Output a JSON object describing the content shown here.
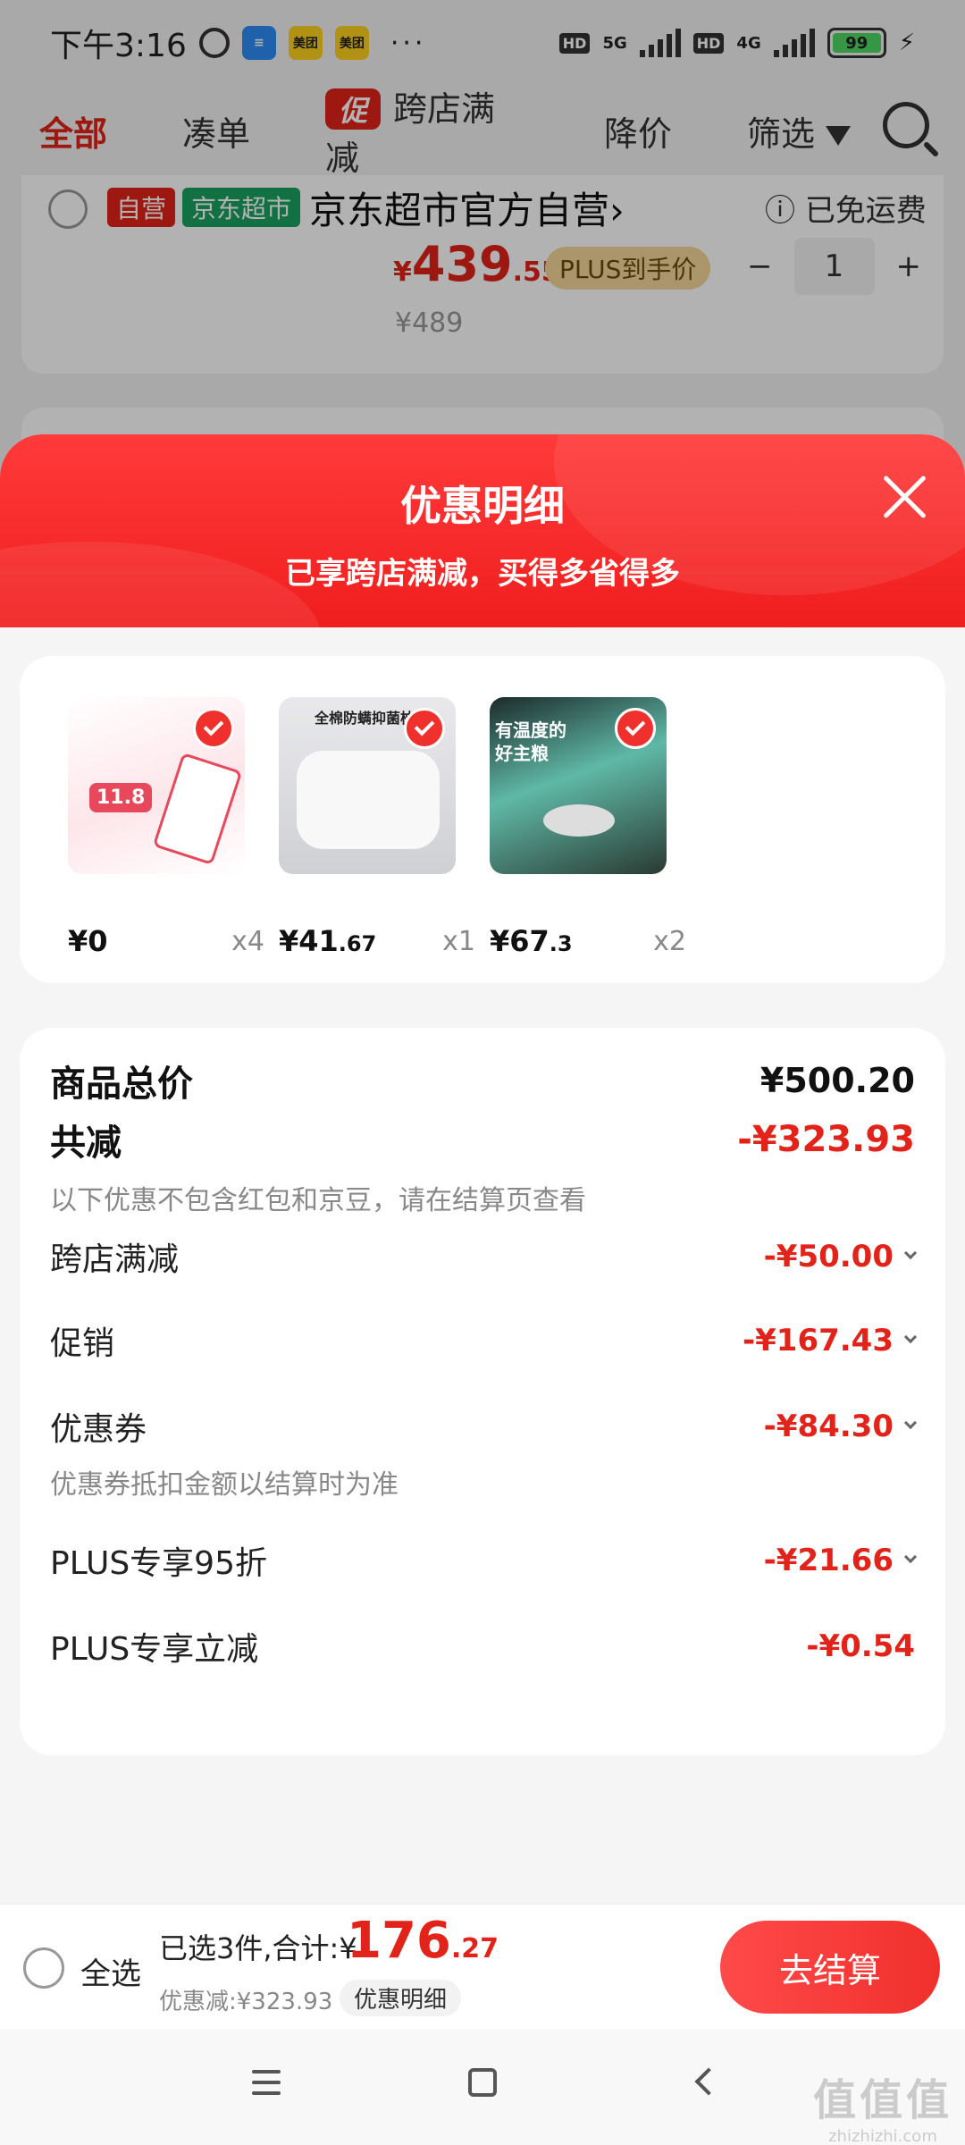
{
  "status_bar": {
    "time": "下午3:16",
    "app_icon_meituan": "美团",
    "dots": "···",
    "signal_1": "5G",
    "signal_2": "4G",
    "hd": "HD",
    "battery": "99"
  },
  "filter_bar": {
    "all": "全部",
    "combine": "凑单",
    "promo_tag": "促",
    "cross_store": "跨店满减",
    "price_drop": "降价",
    "filter": "筛选"
  },
  "background_store": {
    "tag_self": "自营",
    "tag_market": "京东超市",
    "name": "京东超市官方自营",
    "chevron": "›",
    "shipping": "已免运费",
    "price_symbol": "¥",
    "price_int": "439",
    "price_dec": ".55",
    "plus_label": "PLUS到手价",
    "minus": "−",
    "qty": "1",
    "plus": "+",
    "old_price": "¥489"
  },
  "sheet": {
    "title": "优惠明细",
    "subtitle": "已享跨店满减，买得多省得多"
  },
  "products": [
    {
      "price_int": "¥0",
      "price_dec": "",
      "qty": "x4",
      "thumb_text": "11.8"
    },
    {
      "price_int": "¥41",
      "price_dec": ".67",
      "qty": "x1",
      "thumb_text": "全棉防螨抑菌枕"
    },
    {
      "price_int": "¥67",
      "price_dec": ".3",
      "qty": "x2",
      "thumb_text": "有温度的好主粮"
    }
  ],
  "details": {
    "total_label": "商品总价",
    "total_value": "¥500.20",
    "reduce_label": "共减",
    "reduce_value": "-¥323.93",
    "reduce_note": "以下优惠不包含红包和京豆，请在结算页查看",
    "items": [
      {
        "label": "跨店满减",
        "value": "-¥50.00"
      },
      {
        "label": "促销",
        "value": "-¥167.43"
      },
      {
        "label": "优惠券",
        "value": "-¥84.30"
      },
      {
        "label": "PLUS专享95折",
        "value": "-¥21.66"
      },
      {
        "label": "PLUS专享立减",
        "value": "-¥0.54"
      }
    ],
    "coupon_note": "优惠券抵扣金额以结算时为准"
  },
  "checkout": {
    "select_all": "全选",
    "selected_text": "已选3件,合计:¥",
    "amount_int": "176",
    "amount_dec": ".27",
    "reduce_text": "优惠减:¥323.93",
    "detail_pill": "优惠明细",
    "button": "去结算"
  },
  "watermark": {
    "big": "值值值",
    "small": "zhizhizhi.com"
  },
  "colors": {
    "accent": "#e2231a",
    "header_gradient_top": "#ff3a3a",
    "header_gradient_bottom": "#f01e1e"
  }
}
